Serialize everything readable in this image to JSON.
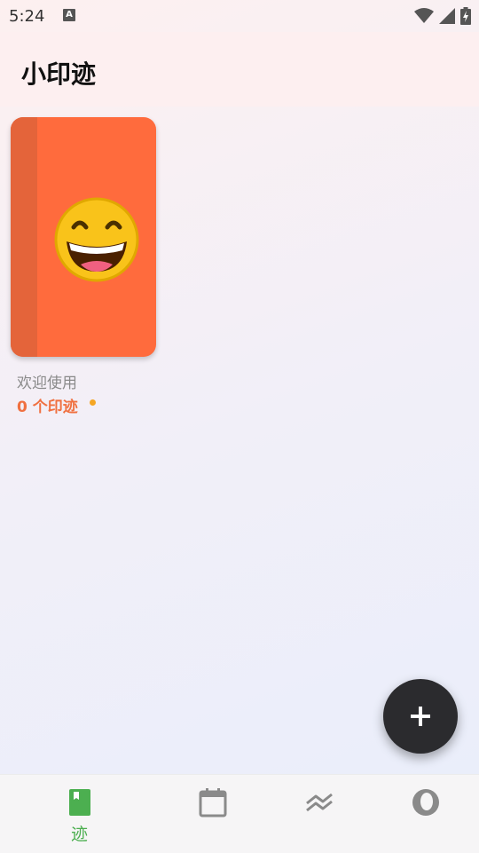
{
  "status_bar": {
    "time": "5:24",
    "notification_icon": "a-icon",
    "icons": [
      "wifi-icon",
      "cell-signal-icon",
      "battery-charging-icon"
    ]
  },
  "header": {
    "title": "小印迹"
  },
  "books": [
    {
      "name": "欢迎使用",
      "count_label": "0 个印迹",
      "cover_emoji": "grinning-face",
      "cover_color": "#ff6b3d",
      "spine_color": "#e4643a"
    }
  ],
  "fab": {
    "icon": "plus-icon"
  },
  "bottom_nav": {
    "items": [
      {
        "id": "traces",
        "icon": "book-icon",
        "label": "迹",
        "active": true
      },
      {
        "id": "calendar",
        "icon": "calendar-icon",
        "label": "",
        "active": false
      },
      {
        "id": "stats",
        "icon": "chevrons-up-icon",
        "label": "",
        "active": false
      },
      {
        "id": "profile",
        "icon": "profile-icon",
        "label": "",
        "active": false
      }
    ]
  },
  "colors": {
    "accent": "#4caf50",
    "book": "#ff6b3d",
    "fab": "#2b2b2e",
    "count_text": "#f07040"
  }
}
